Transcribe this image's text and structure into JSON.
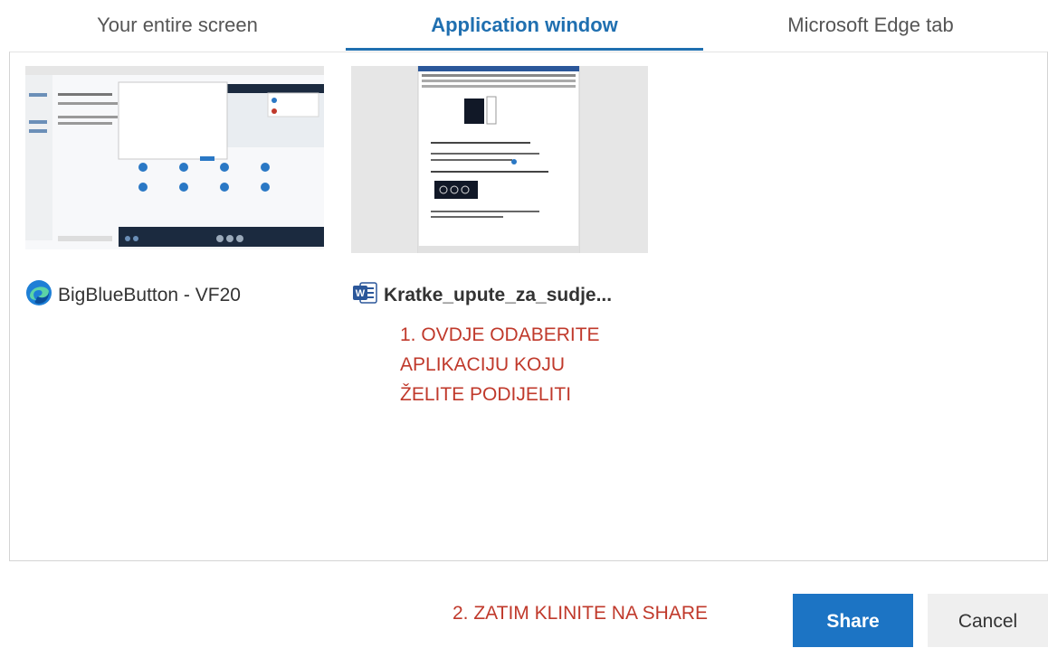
{
  "tabs": [
    {
      "label": "Your entire screen"
    },
    {
      "label": "Application window"
    },
    {
      "label": "Microsoft Edge tab"
    }
  ],
  "windows": [
    {
      "label": "BigBlueButton - VF20",
      "icon": "edge-icon"
    },
    {
      "label": "Kratke_upute_za_sudje...",
      "icon": "word-icon"
    }
  ],
  "instructions": {
    "step1_line1": "1. OVDJE ODABERITE",
    "step1_line2": "APLIKACIJU KOJU",
    "step1_line3": "ŽELITE PODIJELITI",
    "step2": "2. ZATIM KLINITE NA SHARE"
  },
  "buttons": {
    "share": "Share",
    "cancel": "Cancel"
  },
  "colors": {
    "accent": "#1f6fb0",
    "share_button": "#1c74c4",
    "instruction_text": "#c0392b"
  }
}
